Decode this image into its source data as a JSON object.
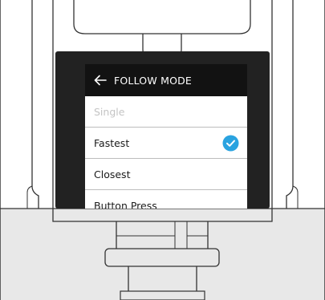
{
  "screen": {
    "title": "FOLLOW MODE",
    "back_icon": "arrow-left-icon",
    "options": [
      {
        "label": "Single",
        "enabled": false,
        "selected": false
      },
      {
        "label": "Fastest",
        "enabled": true,
        "selected": true
      },
      {
        "label": "Closest",
        "enabled": true,
        "selected": false
      },
      {
        "label": "Button Press",
        "enabled": true,
        "selected": false
      }
    ],
    "check_icon": "checkmark-circle-icon"
  },
  "colors": {
    "header_bg": "#121212",
    "bezel": "#222222",
    "accent": "#2aa3e0",
    "disabled_text": "#c4c4c4",
    "outline": "#333333",
    "floor": "#e8e8e8"
  }
}
